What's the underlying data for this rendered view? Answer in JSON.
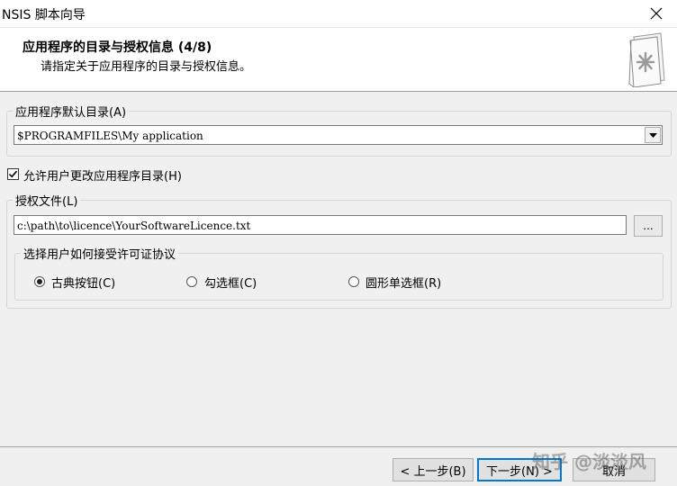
{
  "window": {
    "title": "NSIS 脚本向导"
  },
  "header": {
    "title": "应用程序的目录与授权信息 (4/8)",
    "subtitle": "请指定关于应用程序的目录与授权信息。",
    "icon": "document-asterisk-icon"
  },
  "app_dir_group": {
    "legend": "应用程序默认目录(A)",
    "value": "$PROGRAMFILES\\My application"
  },
  "allow_change": {
    "label": "允许用户更改应用程序目录(H)",
    "checked": true
  },
  "license_group": {
    "legend": "授权文件(L)",
    "path": "c:\\path\\to\\licence\\YourSoftwareLicence.txt",
    "browse_label": "..."
  },
  "accept_group": {
    "legend": "选择用户如何接受许可证协议",
    "options": [
      {
        "label": "古典按钮(C)",
        "selected": true
      },
      {
        "label": "勾选框(C)",
        "selected": false
      },
      {
        "label": "圆形单选框(R)",
        "selected": false
      }
    ]
  },
  "footer": {
    "back_label": "< 上一步(B)",
    "next_label": "下一步(N) >",
    "cancel_label": "取消",
    "watermark": "知乎 @淡淡风"
  },
  "colors": {
    "focus": "#0078d7",
    "panel": "#f0f0f0"
  }
}
